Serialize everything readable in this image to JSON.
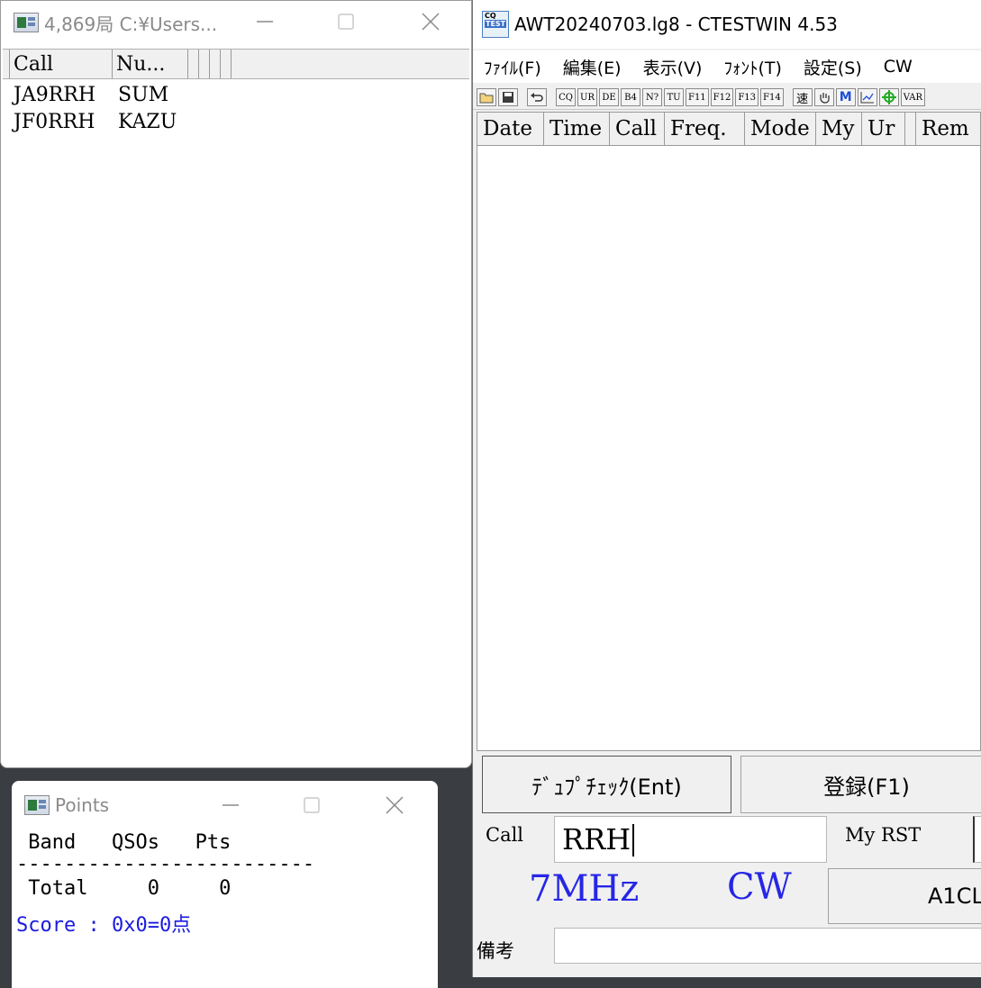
{
  "list_window": {
    "title": "4,869局 C:¥Users...",
    "columns": [
      "Call",
      "Nu..."
    ],
    "rows": [
      {
        "call": "JA9RRH",
        "num": "SUM"
      },
      {
        "call": "JF0RRH",
        "num": "KAZU"
      }
    ]
  },
  "points_window": {
    "title": "Points",
    "header_line": " Band   QSOs   Pts",
    "divider_line": "-------------------------",
    "total_line": " Total     0     0",
    "score_line": "Score : 0x0=0点"
  },
  "main_window": {
    "title": "AWT20240703.lg8   - CTESTWIN  4.53",
    "menu": [
      "ﾌｧｲﾙ(F)",
      "編集(E)",
      "表示(V)",
      "ﾌｫﾝﾄ(T)",
      "設定(S)",
      "CW"
    ],
    "toolbar": [
      "CQ",
      "UR",
      "DE",
      "B4",
      "N?",
      "TU",
      "F11",
      "F12",
      "F13",
      "F14",
      "速",
      "VAR"
    ],
    "log_columns": [
      "Date",
      "Time",
      "Call",
      "Freq.",
      "Mode",
      "My",
      "Ur",
      "",
      "Rem"
    ],
    "dupe_check_label": "ﾃﾞｭﾌﾟﾁｪｯｸ(Ent)",
    "register_label": "登録(F1)",
    "call_label": "Call",
    "call_value": "RRH",
    "my_rst_label": "My RST",
    "band": "7MHz",
    "mode": "CW",
    "a1_button_label": "A1CL",
    "remarks_label": "備考",
    "remarks_value": ""
  },
  "icons": [
    "window-app-icon",
    "minimize-icon",
    "maximize-icon",
    "close-icon",
    "cqtest-app-icon",
    "open-folder-icon",
    "save-icon",
    "undo-icon",
    "hand-icon",
    "m-icon",
    "graph-icon",
    "target-icon"
  ]
}
